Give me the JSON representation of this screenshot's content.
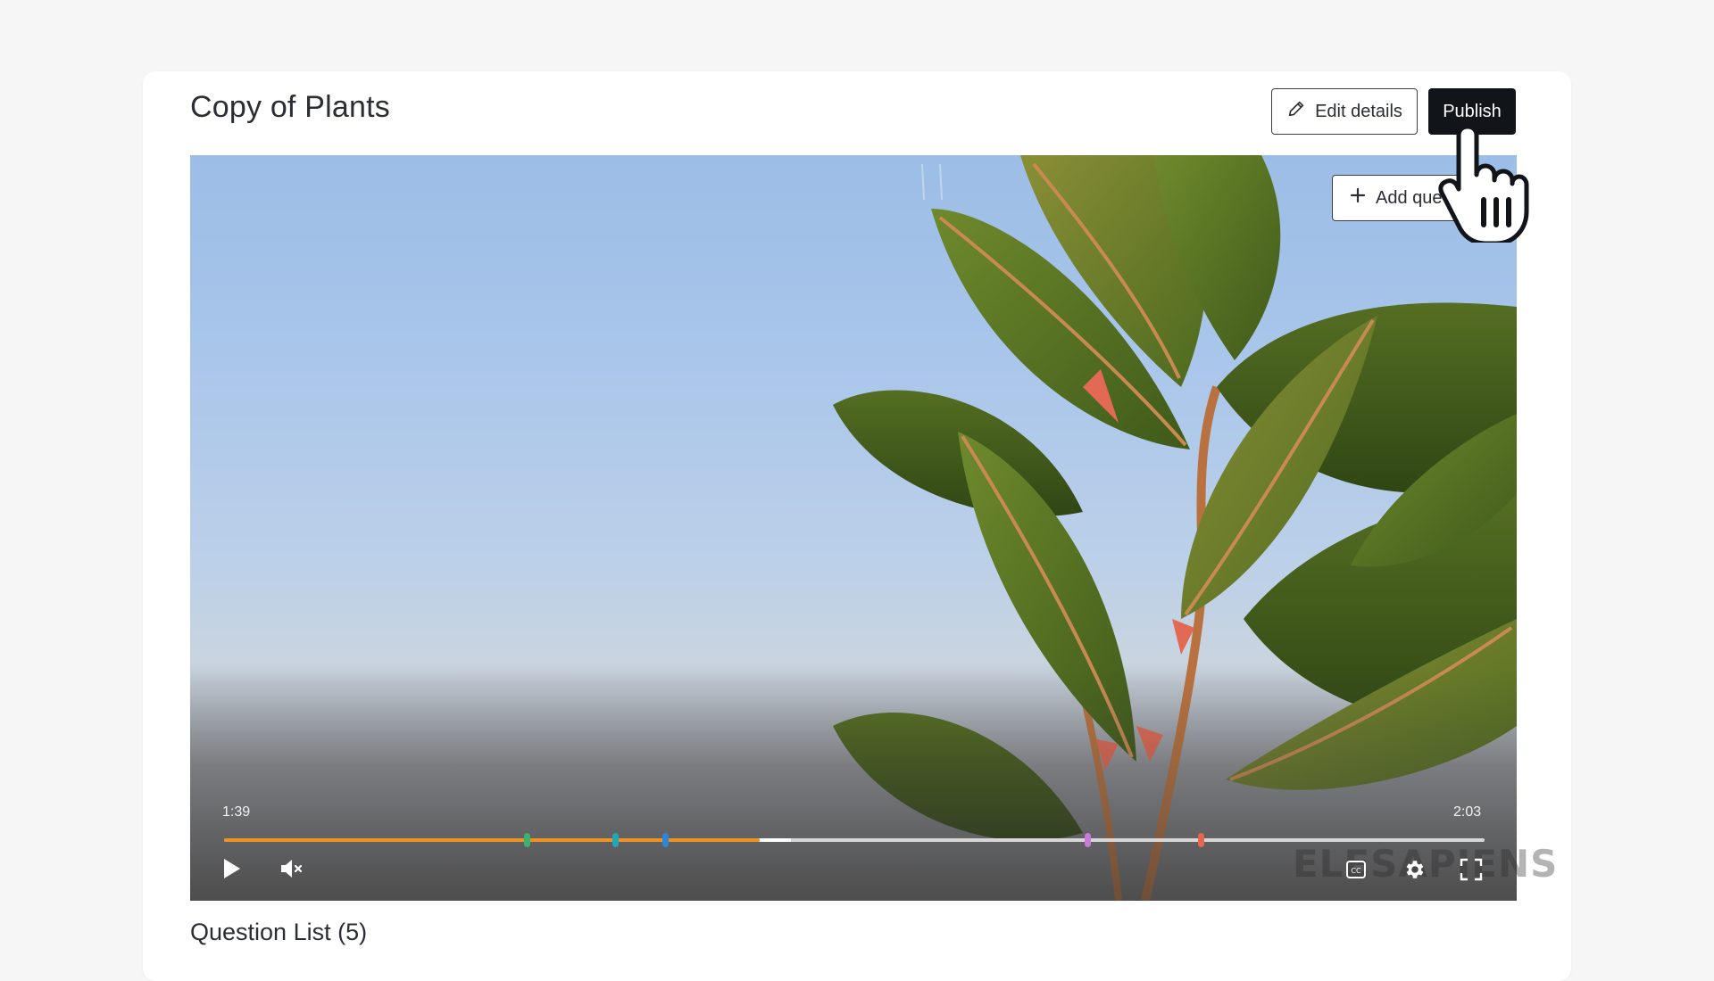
{
  "page": {
    "title": "Copy of Plants"
  },
  "toolbar": {
    "edit_label": "Edit details",
    "publish_label": "Publish"
  },
  "video": {
    "add_question_label": "Add que",
    "current_time": "1:39",
    "duration": "2:03",
    "progress": 0.425,
    "buffered": 0.45,
    "markers": [
      {
        "position": 0.24,
        "color": "#3bb272"
      },
      {
        "position": 0.31,
        "color": "#22a7b8"
      },
      {
        "position": 0.35,
        "color": "#2e86d6"
      },
      {
        "position": 0.685,
        "color": "#c77bd6"
      },
      {
        "position": 0.775,
        "color": "#e8664d"
      }
    ],
    "watermark": "ELESAPIENS",
    "muted": true
  },
  "questions": {
    "heading": "Question List (5)"
  },
  "icons": {
    "edit": "pencil-icon",
    "add": "plus-icon",
    "play": "play-icon",
    "volume": "volume-muted-icon",
    "cc": "closed-captions-icon",
    "settings": "gear-icon",
    "fullscreen": "fullscreen-icon",
    "cursor": "hand-pointer-icon"
  }
}
